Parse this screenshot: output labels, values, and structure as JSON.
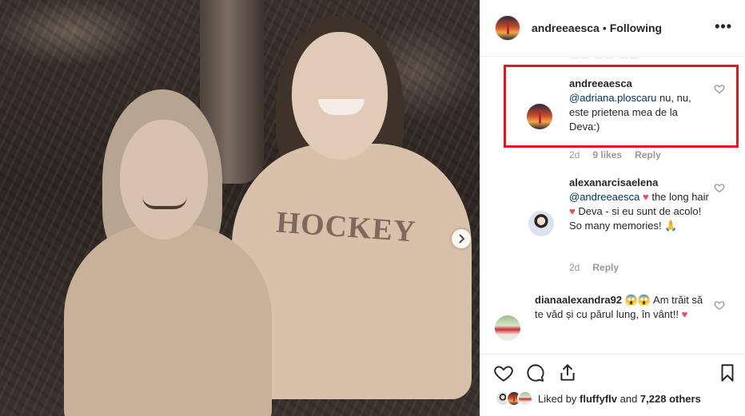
{
  "post_author": {
    "username": "andreeaesca",
    "separator": "•",
    "follow_status": "Following",
    "more_label": "•••"
  },
  "photo": {
    "shirt_print": "HOCKEY",
    "next_icon": "chevron-right-icon"
  },
  "comments": [
    {
      "username": "andreeaesca",
      "mention": "@adriana.ploscaru",
      "text": " nu, nu, este prietena mea de la Deva:)",
      "age": "2d",
      "likes": "9 likes",
      "reply": "Reply",
      "highlighted": true
    },
    {
      "username": "alexanarcisaelena",
      "mention": "@andreeaesca",
      "text_a": " the long hair ",
      "text_b": " Deva - si eu sunt de acolo! So many memories! ",
      "emoji_heart": "♥",
      "emoji_pray": "🙏",
      "age": "2d",
      "reply": "Reply"
    },
    {
      "username": "dianaalexandra92",
      "text": " Am trăit să te văd și cu părul lung, în vânt!! ",
      "emoji_heart": "♥",
      "emoji_scream": "😱😱"
    }
  ],
  "actions": {
    "like_icon": "heart-outline-icon",
    "comment_icon": "comment-icon",
    "share_icon": "share-icon",
    "save_icon": "bookmark-icon"
  },
  "liked_by": {
    "prefix": "Liked by ",
    "user": "fluffyflv",
    "middle": " and ",
    "count": "7,228 others"
  },
  "colors": {
    "highlight_box": "#e0171f",
    "mention": "#003569",
    "heart": "#ed4956",
    "meta_gray": "#999999"
  }
}
